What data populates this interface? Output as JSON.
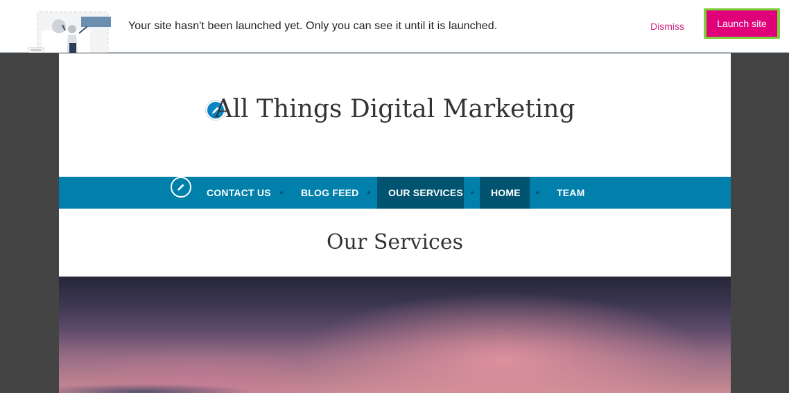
{
  "notice": {
    "message": "Your site hasn't been launched yet. Only you can see it until it is launched.",
    "dismiss_label": "Dismiss",
    "launch_label": "Launch site",
    "accent_color": "#e0007a",
    "highlight_color": "#7fd13b"
  },
  "site": {
    "title": "All Things Digital Marketing",
    "nav": {
      "items": [
        {
          "label": "CONTACT US",
          "active": false
        },
        {
          "label": "BLOG FEED",
          "active": false
        },
        {
          "label": "OUR SERVICES",
          "active": true
        },
        {
          "label": "HOME",
          "active": true
        },
        {
          "label": "TEAM",
          "active": false
        }
      ],
      "background_color": "#0080ab"
    },
    "page_heading": "Our Services",
    "icons": {
      "title_edit": "pencil-icon",
      "nav_edit": "pencil-icon"
    }
  }
}
